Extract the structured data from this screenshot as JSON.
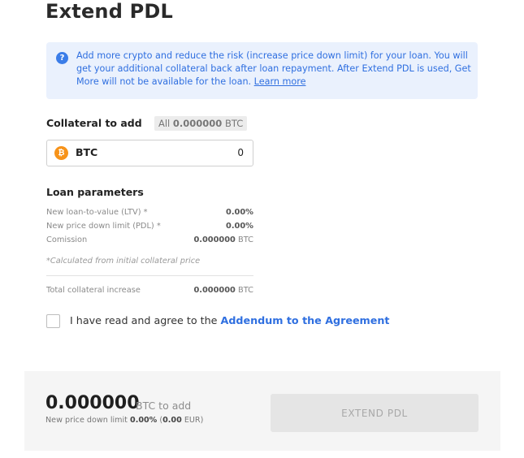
{
  "header": {
    "title": "Extend PDL"
  },
  "info": {
    "icon": "question-icon",
    "text": "Add more crypto and reduce the risk (increase price down limit) for your loan. You will get your additional collateral back after loan repayment. After Extend PDL is used, Get More will not be available for the loan.",
    "link": "Learn more"
  },
  "collateral": {
    "label": "Collateral to add",
    "all_prefix": "All",
    "all_amount": "0.000000",
    "all_unit": "BTC",
    "coin": {
      "icon": "bitcoin-icon",
      "name": "BTC",
      "amount": "0"
    }
  },
  "params": {
    "label": "Loan parameters",
    "ltv": {
      "label": "New loan-to-value (LTV) *",
      "value": "0.00%"
    },
    "pdl": {
      "label": "New price down limit (PDL) *",
      "value": "0.00%"
    },
    "commission": {
      "label": "Comission",
      "value": "0.000000",
      "unit": "BTC"
    },
    "note": "*Calculated from initial collateral price",
    "total": {
      "label": "Total collateral increase",
      "value": "0.000000",
      "unit": "BTC"
    }
  },
  "agreement": {
    "text": "I have read and agree to the",
    "link": "Addendum to the Agreement",
    "checked": false
  },
  "footer": {
    "amount": "0.000000",
    "unit": "BTC to add",
    "sub_prefix": "New price down limit",
    "sub_percent": "0.00%",
    "sub_fiat": "0.00",
    "sub_currency": "EUR",
    "button": "EXTEND PDL"
  },
  "colors": {
    "accent": "#2f6fe0",
    "info_bg": "#eaf1fd",
    "bitcoin": "#f7931a",
    "disabled_button": "#e5e5e5"
  }
}
